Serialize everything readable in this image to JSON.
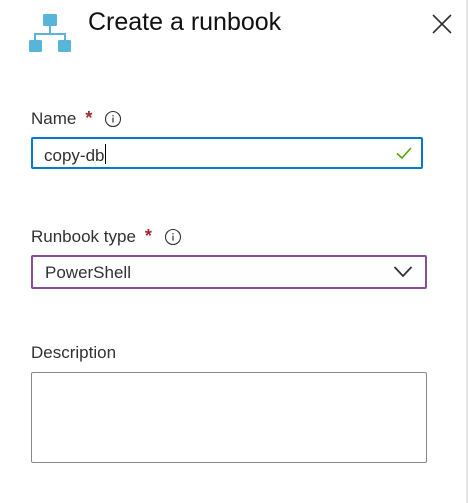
{
  "header": {
    "title": "Create a runbook",
    "icon": "runbook-hierarchy-icon",
    "close_icon": "close-icon"
  },
  "form": {
    "name": {
      "label": "Name",
      "required_marker": "*",
      "info_icon": "info-icon",
      "value": "copy-db",
      "valid_icon": "check-icon"
    },
    "runbook_type": {
      "label": "Runbook type",
      "required_marker": "*",
      "info_icon": "info-icon",
      "selected": "PowerShell",
      "dropdown_icon": "chevron-down-icon"
    },
    "description": {
      "label": "Description",
      "value": ""
    }
  },
  "colors": {
    "accent_blue": "#0078d4",
    "focus_purple": "#8a4d9e",
    "required_red": "#a4262c",
    "valid_green": "#57a300",
    "icon_blue": "#59b4d9"
  }
}
